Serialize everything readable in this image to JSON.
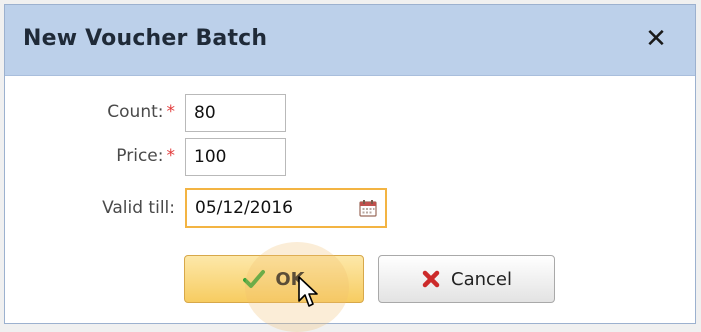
{
  "dialog": {
    "title": "New Voucher Batch",
    "close_glyph": "✕"
  },
  "form": {
    "count": {
      "label": "Count:",
      "required_mark": "*",
      "value": "80"
    },
    "price": {
      "label": "Price:",
      "required_mark": "*",
      "value": "100"
    },
    "valid_till": {
      "label": "Valid till:",
      "value": "05/12/2016",
      "icon": "calendar-icon"
    }
  },
  "buttons": {
    "ok": {
      "label": "OK",
      "icon": "checkmark-icon"
    },
    "cancel": {
      "label": "Cancel",
      "icon": "x-icon"
    }
  },
  "colors": {
    "titlebar": "#bcd0ea",
    "required": "#e23a3a",
    "focus_border": "#f3b443",
    "ok_button": "#f7cc61",
    "check_green": "#3aa53a",
    "cancel_red": "#cc2a2a"
  }
}
